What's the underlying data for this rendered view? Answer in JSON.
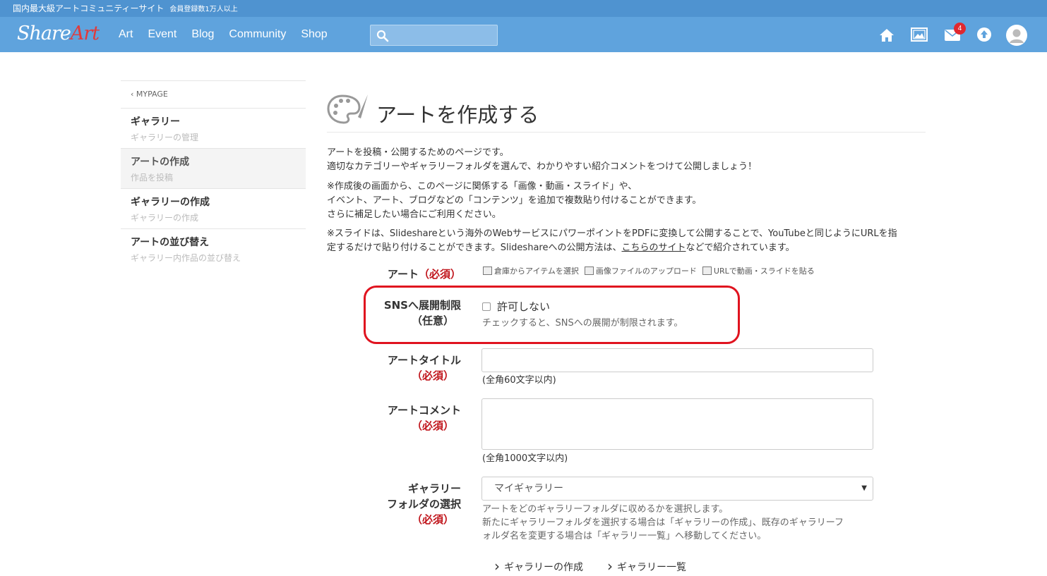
{
  "topbar": {
    "title": "国内最大級アートコミュニティーサイト",
    "members": "会員登録数1万人以上"
  },
  "logo": {
    "share": "Share",
    "art": "Art"
  },
  "nav": {
    "items": [
      "Art",
      "Event",
      "Blog",
      "Community",
      "Shop"
    ],
    "search_placeholder": ""
  },
  "icons": {
    "mail_badge": "4"
  },
  "sidebar": {
    "back": "MYPAGE",
    "items": [
      {
        "title": "ギャラリー",
        "sub": "ギャラリーの管理"
      },
      {
        "title": "アートの作成",
        "sub": "作品を投稿"
      },
      {
        "title": "ギャラリーの作成",
        "sub": "ギャラリーの作成"
      },
      {
        "title": "アートの並び替え",
        "sub": "ギャラリー内作品の並び替え"
      }
    ]
  },
  "main": {
    "title": "アートを作成する",
    "desc1_l1": "アートを投稿・公開するためのページです。",
    "desc1_l2": "適切なカテゴリーやギャラリーフォルダを選んで、わかりやすい紹介コメントをつけて公開しましょう！",
    "desc2_l1": "※作成後の画面から、このページに関係する「画像・動画・スライド」や、",
    "desc2_l2": "イベント、アート、ブログなどの「コンテンツ」を追加で複数貼り付けることができます。",
    "desc2_l3": "さらに補足したい場合にご利用ください。",
    "desc3_l1": "※スライドは、Slideshareという海外のWebサービスにパワーポイントをPDFに変換して公開することで、YouTubeと同じようにURLを指",
    "desc3_l2a": "定するだけで貼り付けることができます。Slideshareへの公開方法は、",
    "desc3_link": "こちらのサイト",
    "desc3_l2b": "などで紹介されています。"
  },
  "form": {
    "required": "（必須）",
    "optional": "（任意）",
    "art_label": "アート",
    "art_links": [
      "倉庫からアイテムを選択",
      "画像ファイルのアップロード",
      "URLで動画・スライドを貼る"
    ],
    "sns_label": "SNSへ展開制限",
    "sns_checkbox": "許可しない",
    "sns_note": "チェックすると、SNSへの展開が制限されます。",
    "title_label": "アートタイトル",
    "title_limit": "(全角60文字以内)",
    "comment_label": "アートコメント",
    "comment_limit": "(全角1000文字以内)",
    "gallery_label_1": "ギャラリー",
    "gallery_label_2": "フォルダの選択",
    "gallery_selected": "マイギャラリー",
    "gallery_note_1": "アートをどのギャラリーフォルダに収めるかを選択します。",
    "gallery_note_2": "新たにギャラリーフォルダを選択する場合は「ギャラリーの作成」、既存のギャラリーフ",
    "gallery_note_3": "ォルダ名を変更する場合は「ギャラリー一覧」へ移動してください。",
    "bottom_links": [
      "ギャラリーの作成",
      "ギャラリー一覧"
    ]
  },
  "colors": {
    "nav_bg": "#5fa3dd",
    "topstrip_bg": "#4f93d0",
    "required": "#c0141b",
    "highlight": "#e0131f"
  }
}
